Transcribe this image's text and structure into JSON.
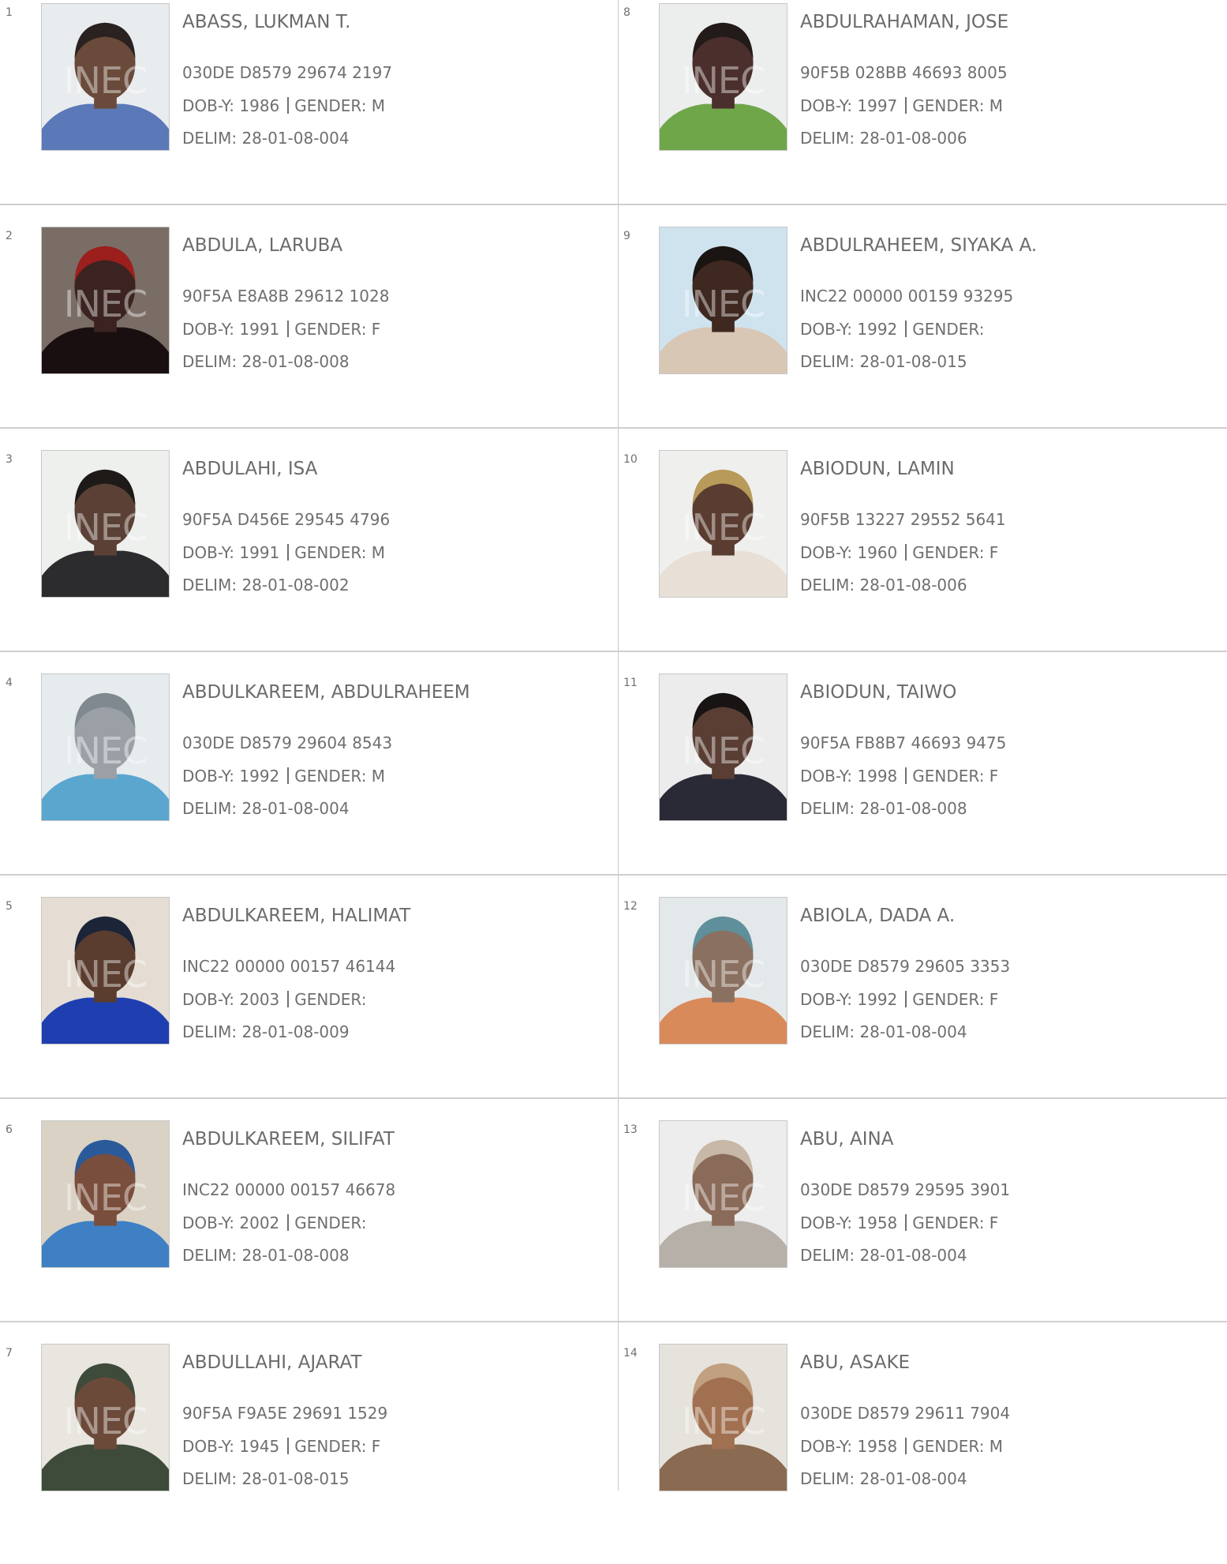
{
  "photo_watermark": "INEC",
  "labels": {
    "dob": "DOB-Y:",
    "gender": "GENDER:",
    "delim": "DELIM:"
  },
  "voters": [
    {
      "sn": "1",
      "name": "ABASS, LUKMAN T.",
      "vin": "030DE D8579 29674 2197",
      "dob": "1986",
      "gender": "M",
      "delim": "28-01-08-004",
      "photo": {
        "bg": "#e9ecef",
        "skin": "#6a4a3a",
        "cloth": "#5b78b8",
        "hair": "#2a2220"
      }
    },
    {
      "sn": "2",
      "name": "ABDULA, LARUBA",
      "vin": "90F5A E8A8B 29612 1028",
      "dob": "1991",
      "gender": "F",
      "delim": "28-01-08-008",
      "photo": {
        "bg": "#7a6d66",
        "skin": "#3a2320",
        "cloth": "#1a0f10",
        "hair": "#9b1f1c"
      }
    },
    {
      "sn": "3",
      "name": "ABDULAHI, ISA",
      "vin": "90F5A D456E 29545 4796",
      "dob": "1991",
      "gender": "M",
      "delim": "28-01-08-002",
      "photo": {
        "bg": "#eef0ee",
        "skin": "#5a4035",
        "cloth": "#2c2c2e",
        "hair": "#1e1a18"
      }
    },
    {
      "sn": "4",
      "name": "ABDULKAREEM, ABDULRAHEEM",
      "vin": "030DE D8579 29604 8543",
      "dob": "1992",
      "gender": "M",
      "delim": "28-01-08-004",
      "photo": {
        "bg": "#e6ebee",
        "skin": "#9aa0a6",
        "cloth": "#5aa6cf",
        "hair": "#808890"
      }
    },
    {
      "sn": "5",
      "name": "ABDULKAREEM, HALIMAT",
      "vin": "INC22 00000 00157 46144",
      "dob": "2003",
      "gender": "",
      "delim": "28-01-08-009",
      "photo": {
        "bg": "#e5ddd3",
        "skin": "#5b3d30",
        "cloth": "#1f3fb0",
        "hair": "#1c2438"
      }
    },
    {
      "sn": "6",
      "name": "ABDULKAREEM, SILIFAT",
      "vin": "INC22 00000 00157 46678",
      "dob": "2002",
      "gender": "",
      "delim": "28-01-08-008",
      "photo": {
        "bg": "#d9d2c5",
        "skin": "#7a4e3c",
        "cloth": "#3f7fc4",
        "hair": "#2a5a9a"
      }
    },
    {
      "sn": "7",
      "name": "ABDULLAHI, AJARAT",
      "vin": "90F5A F9A5E 29691 1529",
      "dob": "1945",
      "gender": "F",
      "delim": "28-01-08-015",
      "photo": {
        "bg": "#e9e6df",
        "skin": "#6b4a3a",
        "cloth": "#3e4a3a",
        "hair": "#3e4a3a"
      }
    },
    {
      "sn": "8",
      "name": "ABDULRAHAMAN, JOSE",
      "vin": "90F5B 028BB 46693 8005",
      "dob": "1997",
      "gender": "M",
      "delim": "28-01-08-006",
      "photo": {
        "bg": "#eceeed",
        "skin": "#4a2f2c",
        "cloth": "#6fa64a",
        "hair": "#231a1a"
      }
    },
    {
      "sn": "9",
      "name": "ABDULRAHEEM, SIYAKA A.",
      "vin": "INC22 00000 00159 93295",
      "dob": "1992",
      "gender": "",
      "delim": "28-01-08-015",
      "photo": {
        "bg": "#cfe3ef",
        "skin": "#3e2820",
        "cloth": "#d9c7b5",
        "hair": "#1a1412"
      }
    },
    {
      "sn": "10",
      "name": "ABIODUN, LAMIN",
      "vin": "90F5B 13227 29552 5641",
      "dob": "1960",
      "gender": "F",
      "delim": "28-01-08-006",
      "photo": {
        "bg": "#efefee",
        "skin": "#5a3d30",
        "cloth": "#e8e0d6",
        "hair": "#b89a5a"
      }
    },
    {
      "sn": "11",
      "name": "ABIODUN, TAIWO",
      "vin": "90F5A FB8B7 46693 9475",
      "dob": "1998",
      "gender": "F",
      "delim": "28-01-08-008",
      "photo": {
        "bg": "#ececec",
        "skin": "#5a3e34",
        "cloth": "#2a2a36",
        "hair": "#181414"
      }
    },
    {
      "sn": "12",
      "name": "ABIOLA, DADA A.",
      "vin": "030DE D8579 29605 3353",
      "dob": "1992",
      "gender": "F",
      "delim": "28-01-08-004",
      "photo": {
        "bg": "#e3e8ea",
        "skin": "#8a7060",
        "cloth": "#d98a5a",
        "hair": "#5f8f9a"
      }
    },
    {
      "sn": "13",
      "name": "ABU, AINA",
      "vin": "030DE D8579 29595 3901",
      "dob": "1958",
      "gender": "F",
      "delim": "28-01-08-004",
      "photo": {
        "bg": "#ecedec",
        "skin": "#8a6a58",
        "cloth": "#b7b0a8",
        "hair": "#c7b8a8"
      }
    },
    {
      "sn": "14",
      "name": "ABU, ASAKE",
      "vin": "030DE D8579 29611 7904",
      "dob": "1958",
      "gender": "M",
      "delim": "28-01-08-004",
      "photo": {
        "bg": "#e6e2dc",
        "skin": "#a07050",
        "cloth": "#8a6a50",
        "hair": "#c0a080"
      }
    }
  ]
}
